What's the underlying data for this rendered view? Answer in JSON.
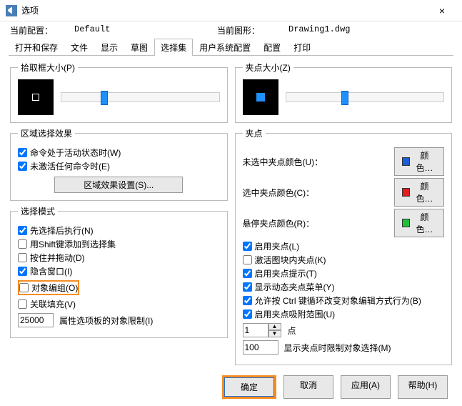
{
  "window": {
    "title": "选项",
    "close": "×"
  },
  "header": {
    "currentConfigLabel": "当前配置：",
    "currentConfigValue": "Default",
    "currentDrawingLabel": "当前图形：",
    "currentDrawingValue": "Drawing1.dwg"
  },
  "tabs": [
    "打开和保存",
    "文件",
    "显示",
    "草图",
    "选择集",
    "用户系统配置",
    "配置",
    "打印"
  ],
  "activeTabIndex": 4,
  "left": {
    "pickbox": {
      "legend": "拾取框大小(P)",
      "sliderPos": 25
    },
    "region": {
      "legend": "区域选择效果",
      "cmdActive": "命令处于活动状态时(W)",
      "cmdActiveChecked": true,
      "noCmdActive": "未激活任何命令时(E)",
      "noCmdActiveChecked": true,
      "settingsBtn": "区域效果设置(S)..."
    },
    "mode": {
      "legend": "选择模式",
      "items": [
        {
          "label": "先选择后执行(N)",
          "checked": true
        },
        {
          "label": "用Shift键添加到选择集",
          "checked": false
        },
        {
          "label": "按住并拖动(D)",
          "checked": false
        },
        {
          "label": "隐含窗口(I)",
          "checked": true
        },
        {
          "label": "对象编组(O)",
          "checked": false,
          "hl": true
        },
        {
          "label": "关联填充(V)",
          "checked": false
        }
      ],
      "limitValue": "25000",
      "limitLabel": "属性选项板的对象限制(I)"
    }
  },
  "right": {
    "gripsize": {
      "legend": "夹点大小(Z)",
      "sliderPos": 35
    },
    "grips": {
      "legend": "夹点",
      "colors": [
        {
          "label": "未选中夹点颜色(U)：",
          "swatch": "#1e5bd8",
          "btn": "颜色…"
        },
        {
          "label": "选中夹点颜色(C)：",
          "swatch": "#e01f1f",
          "btn": "颜色…"
        },
        {
          "label": "悬停夹点颜色(R)：",
          "swatch": "#1fbf3a",
          "btn": "颜色…"
        }
      ],
      "checks": [
        {
          "label": "启用夹点(L)",
          "checked": true
        },
        {
          "label": "激活图块内夹点(K)",
          "checked": false
        },
        {
          "label": "启用夹点提示(T)",
          "checked": true
        },
        {
          "label": "显示动态夹点菜单(Y)",
          "checked": true
        },
        {
          "label": "允许按 Ctrl 键循环改变对象编辑方式行为(B)",
          "checked": true
        },
        {
          "label": "启用夹点吸附范围(U)",
          "checked": true
        }
      ],
      "spinValue": "1",
      "spinLabel": "点",
      "limitValue": "100",
      "limitLabel": "显示夹点时限制对象选择(M)"
    }
  },
  "footer": {
    "ok": "确定",
    "cancel": "取消",
    "apply": "应用(A)",
    "help": "帮助(H)"
  }
}
